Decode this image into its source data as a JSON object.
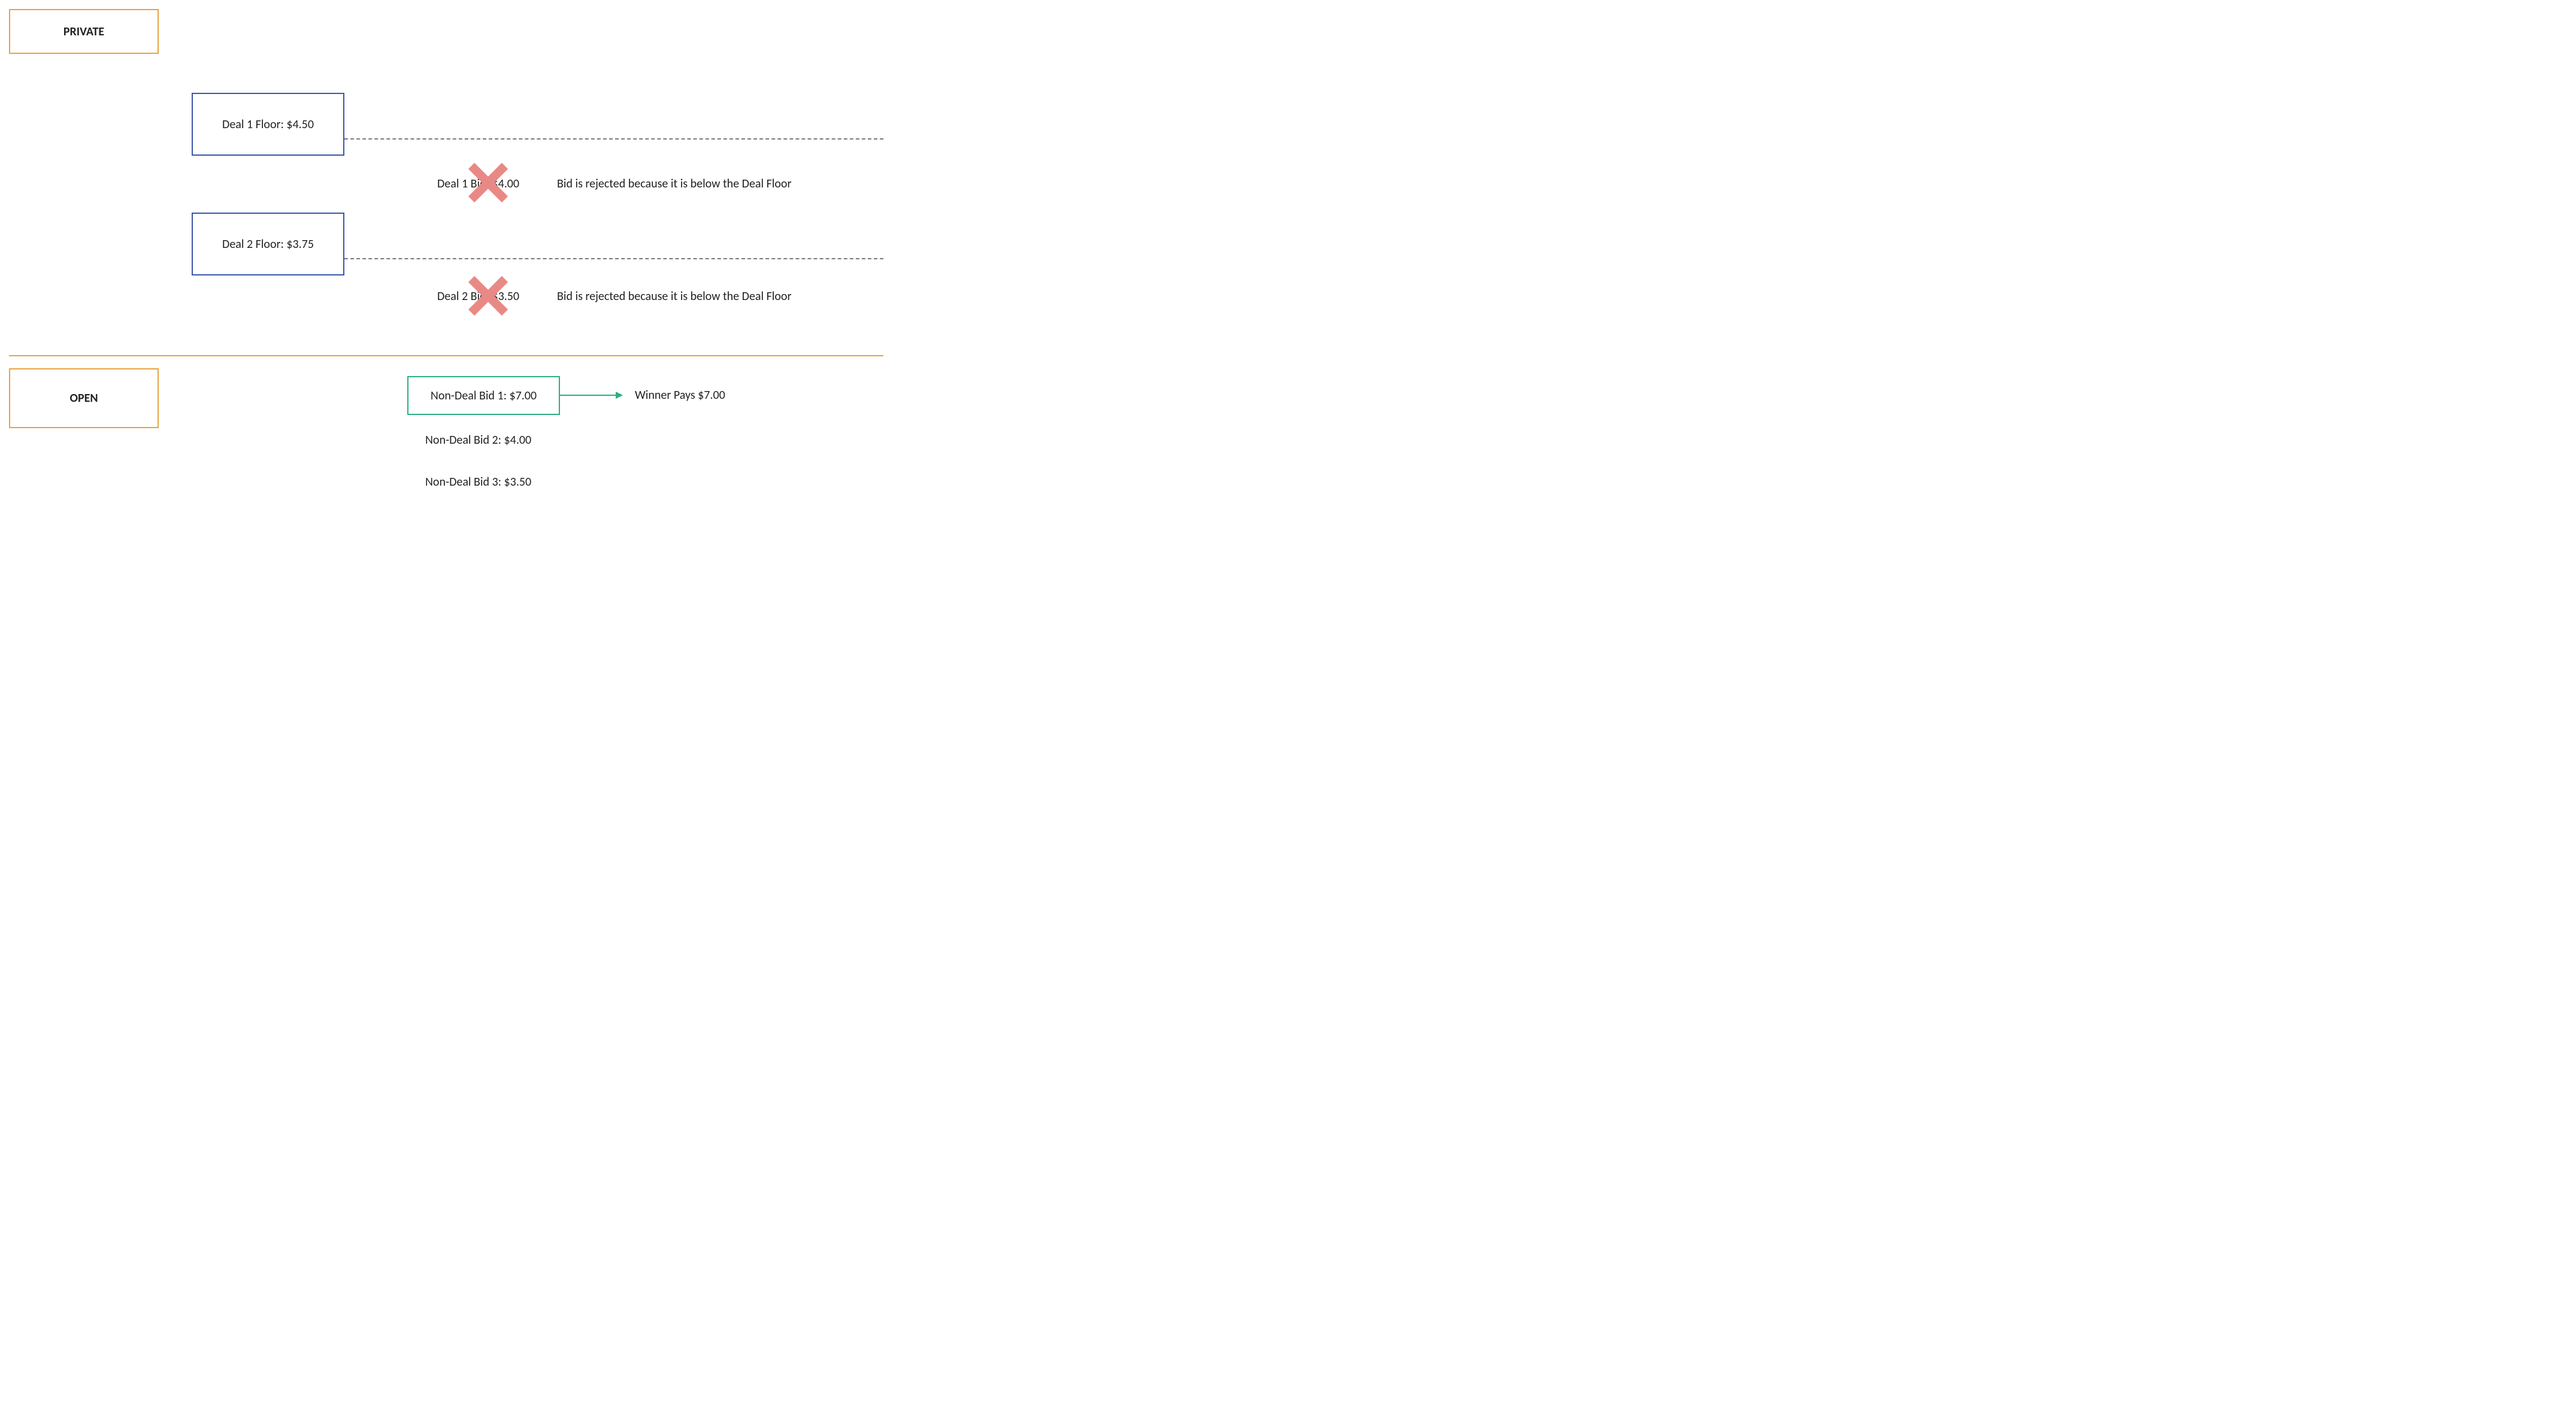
{
  "sections": {
    "private_label": "PRIVATE",
    "open_label": "OPEN"
  },
  "deals": {
    "deal1_floor_label": "Deal 1 Floor: $4.50",
    "deal2_floor_label": "Deal 2 Floor: $3.75",
    "deal1_bid_label": "Deal 1 Bid: $4.00",
    "deal2_bid_label": "Deal 2 Bid: $3.50",
    "rejected_text_1": "Bid is rejected because it is below the Deal Floor",
    "rejected_text_2": "Bid is rejected because it is below the Deal Floor"
  },
  "open_bids": {
    "bid1_label": "Non-Deal Bid 1: $7.00",
    "bid2_label": "Non-Deal Bid 2: $4.00",
    "bid3_label": "Non-Deal Bid 3: $3.50",
    "winner_text": "Winner Pays $7.00"
  },
  "colors": {
    "orange": "#e8a33d",
    "blue": "#3b57a6",
    "green": "#2bb07f",
    "red_x": "#e98986",
    "dashed_grey": "#7a7a7a"
  }
}
